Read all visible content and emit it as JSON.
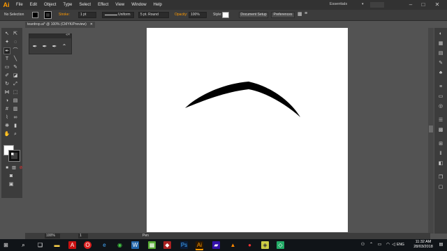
{
  "app": {
    "logo": "Ai"
  },
  "menu": [
    "File",
    "Edit",
    "Object",
    "Type",
    "Select",
    "Effect",
    "View",
    "Window",
    "Help"
  ],
  "workspace": {
    "label": "Essentials"
  },
  "window_controls": {
    "minimize": "–",
    "maximize": "□",
    "close": "✕"
  },
  "control_bar": {
    "selection": "No Selection",
    "stroke_label": "Stroke:",
    "stroke_weight": "1 pt",
    "profile": "Uniform",
    "brush": "5 pt. Round",
    "opacity_label": "Opacity:",
    "opacity_value": "100%",
    "style_label": "Style:",
    "document_setup": "Document Setup",
    "preferences": "Preferences"
  },
  "document": {
    "tab_title": "teardrop.ai* @ 100% (CMYK/Preview)",
    "close": "✕"
  },
  "status_bar": {
    "zoom": "100%",
    "artboard": "1",
    "mode": "Pen"
  },
  "taskbar": {
    "clock_time": "11:32 AM",
    "clock_date": "28/03/2018",
    "language": "ENG"
  },
  "colors": {
    "accent": "#ff9a00",
    "canvas": "#ffffff",
    "ui_dark": "#3c3c3c"
  }
}
